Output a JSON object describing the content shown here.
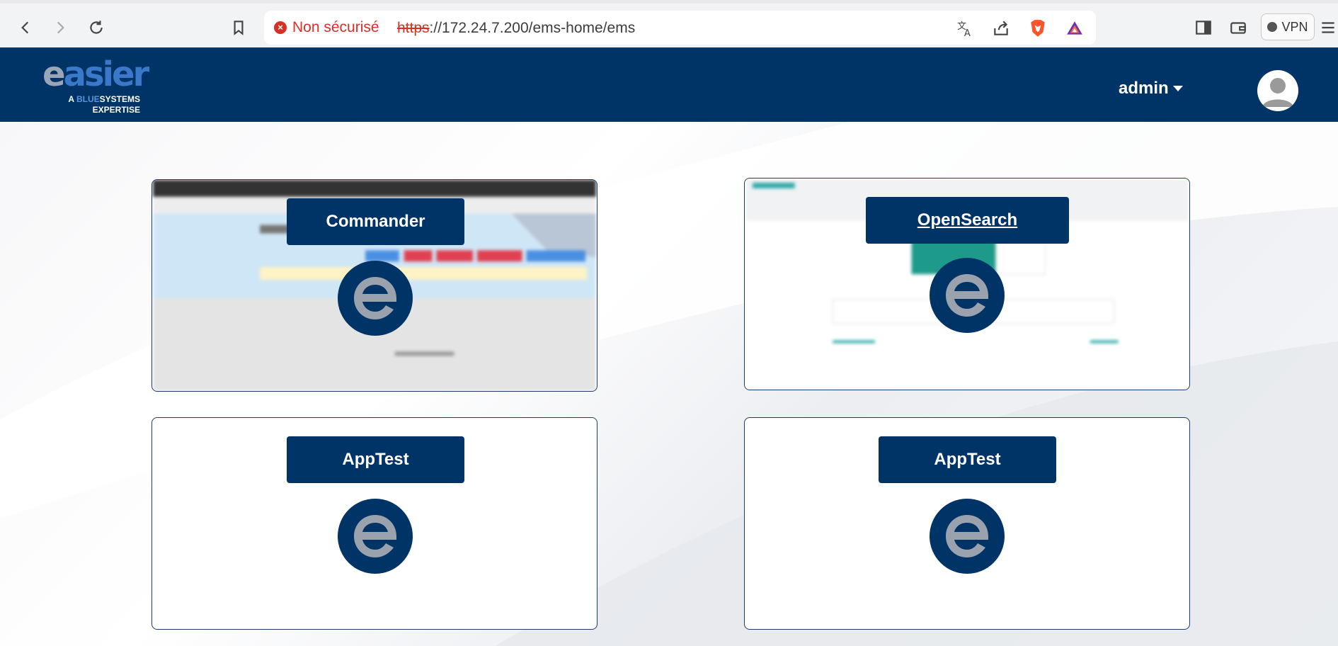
{
  "browser": {
    "security_label": "Non sécurisé",
    "url_protocol": "https",
    "url_rest": "://172.24.7.200/ems-home/ems",
    "vpn_label": "VPN"
  },
  "header": {
    "logo_word_a": "e",
    "logo_word_b": "asier",
    "logo_sub_line1_a": "A ",
    "logo_sub_line1_b": "BLUE",
    "logo_sub_line1_c": "SYSTEMS",
    "logo_sub_line2": "EXPERTISE",
    "user_name": "admin"
  },
  "apps": [
    {
      "label": "Commander"
    },
    {
      "label": "OpenSearch"
    },
    {
      "label": "AppTest"
    },
    {
      "label": "AppTest"
    }
  ],
  "colors": {
    "brand_navy": "#003366",
    "logo_grey": "#9aa5b8",
    "insecure_red": "#d93025"
  }
}
